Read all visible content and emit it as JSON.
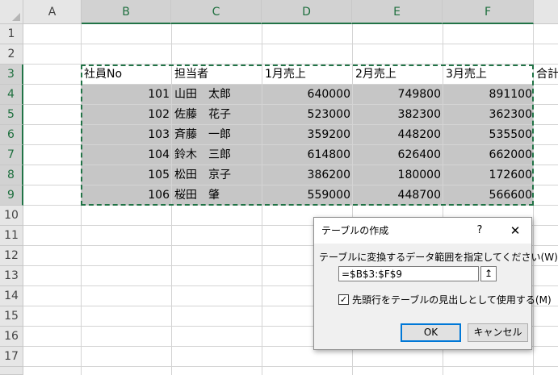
{
  "columns": [
    "A",
    "B",
    "C",
    "D",
    "E",
    "F"
  ],
  "rows": [
    "1",
    "2",
    "3",
    "4",
    "5",
    "6",
    "7",
    "8",
    "9",
    "10",
    "11",
    "12",
    "13",
    "14",
    "15",
    "16",
    "17"
  ],
  "header_row": [
    "社員No",
    "担当者",
    "1月売上",
    "2月売上",
    "3月売上",
    "合計"
  ],
  "data_rows": [
    {
      "no": "101",
      "name": "山田　太郎",
      "jan": "640000",
      "feb": "749800",
      "mar": "891100"
    },
    {
      "no": "102",
      "name": "佐藤　花子",
      "jan": "523000",
      "feb": "382300",
      "mar": "362300"
    },
    {
      "no": "103",
      "name": "斉藤　一郎",
      "jan": "359200",
      "feb": "448200",
      "mar": "535500"
    },
    {
      "no": "104",
      "name": "鈴木　三郎",
      "jan": "614800",
      "feb": "626400",
      "mar": "662000"
    },
    {
      "no": "105",
      "name": "松田　京子",
      "jan": "386200",
      "feb": "180000",
      "mar": "172600"
    },
    {
      "no": "106",
      "name": "桜田　肇",
      "jan": "559000",
      "feb": "448700",
      "mar": "566600"
    }
  ],
  "dialog": {
    "title": "テーブルの作成",
    "help": "?",
    "close": "✕",
    "range_label": "テーブルに変換するデータ範囲を指定してください(W)",
    "range_value": "=$B$3:$F$9",
    "collapse_icon": "↥",
    "checkbox_checked": true,
    "checkbox_mark": "✓",
    "checkbox_label": "先頭行をテーブルの見出しとして使用する(M)",
    "ok": "OK",
    "cancel": "キャンセル"
  },
  "colors": {
    "accent": "#217346",
    "selection": "#c6c6c6",
    "header_bg": "#e6e6e6",
    "focus": "#0078d7"
  }
}
